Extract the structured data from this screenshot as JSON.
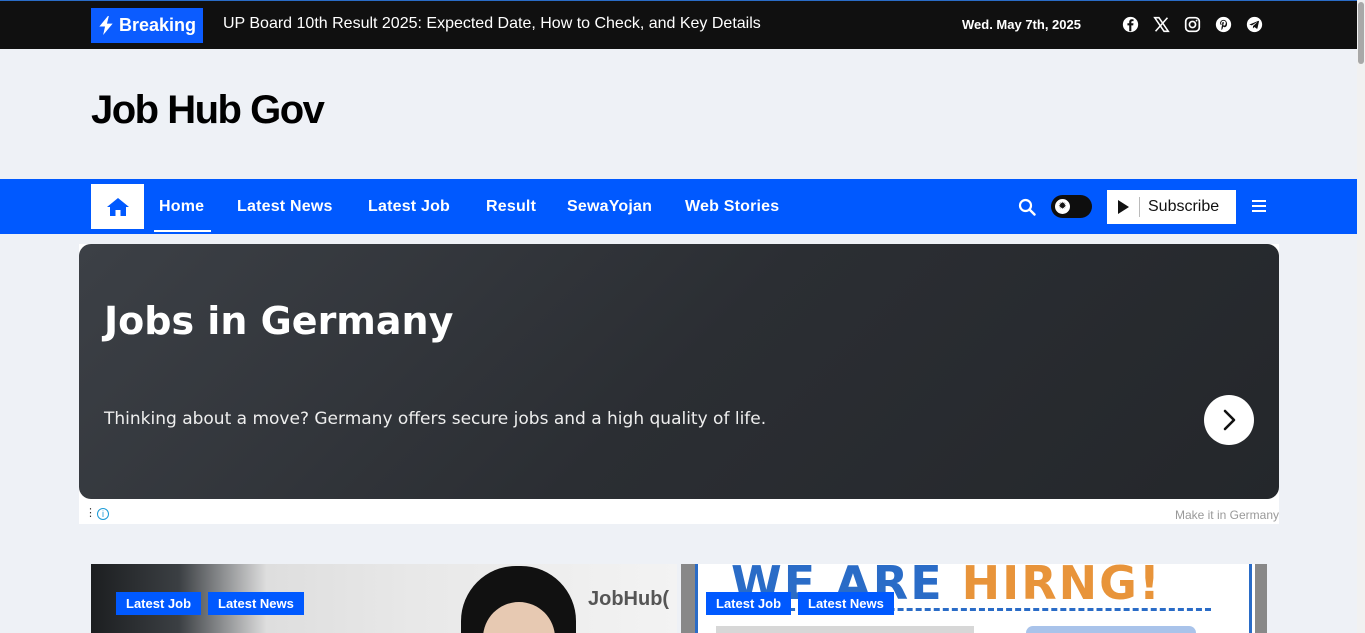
{
  "topbar": {
    "breaking_label": "Breaking",
    "ticker_text": "UP Board 10th Result 2025: Expected Date, How to Check, and Key Details",
    "date": "Wed. May 7th, 2025",
    "socials": [
      "facebook-icon",
      "x-icon",
      "instagram-icon",
      "pinterest-icon",
      "telegram-icon"
    ]
  },
  "site": {
    "title": "Job Hub Gov"
  },
  "nav": {
    "items": [
      {
        "label": "Home",
        "active": true
      },
      {
        "label": "Latest News"
      },
      {
        "label": "Latest Job"
      },
      {
        "label": "Result"
      },
      {
        "label": "SewaYojan"
      },
      {
        "label": "Web Stories"
      }
    ],
    "subscribe_label": "Subscribe"
  },
  "ad": {
    "title": "Jobs in Germany",
    "text": "Thinking about a move? Germany offers secure jobs and a high quality of life.",
    "sponsor": "Make it in Germany"
  },
  "cards": [
    {
      "tags": [
        "Latest Job",
        "Latest News"
      ],
      "watermark": "JobHub("
    },
    {
      "tags": [
        "Latest Job",
        "Latest News"
      ],
      "image_text_1": "WE ARE",
      "image_text_2": "HIRNG!"
    }
  ],
  "colors": {
    "accent": "#0059ff",
    "topbar": "#101010",
    "background": "#eef1f6"
  }
}
